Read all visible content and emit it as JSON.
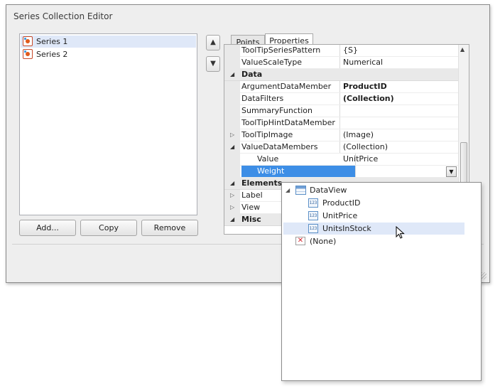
{
  "window": {
    "title": "Series Collection Editor"
  },
  "series_list": {
    "items": [
      "Series 1",
      "Series 2"
    ],
    "selected": 0
  },
  "buttons": {
    "add": "Add...",
    "copy": "Copy",
    "remove": "Remove"
  },
  "tabs": [
    {
      "label": "Points",
      "active": false
    },
    {
      "label": "Properties",
      "active": true
    }
  ],
  "property_grid": {
    "rows": [
      {
        "name": "ToolTipSeriesPattern",
        "value": "{S}"
      },
      {
        "name": "ValueScaleType",
        "value": "Numerical"
      },
      {
        "category": "Data"
      },
      {
        "name": "ArgumentDataMember",
        "value": "ProductID"
      },
      {
        "name": "DataFilters",
        "value": "(Collection)"
      },
      {
        "name": "SummaryFunction",
        "value": ""
      },
      {
        "name": "ToolTipHintDataMember",
        "value": ""
      },
      {
        "name": "ToolTipImage",
        "value": "(Image)"
      },
      {
        "name": "ValueDataMembers",
        "value": "(Collection)"
      },
      {
        "name": "Value",
        "value": "UnitPrice"
      },
      {
        "name": "Weight",
        "value": ""
      },
      {
        "category": "Elements"
      },
      {
        "name": "Label",
        "value": ""
      },
      {
        "name": "View",
        "value": ""
      },
      {
        "category": "Misc"
      }
    ]
  },
  "dropdown": {
    "root": "DataView",
    "fields": [
      "ProductID",
      "UnitPrice",
      "UnitsInStock"
    ],
    "hovered": "UnitsInStock",
    "none": "(None)",
    "field_icon_text": "123"
  },
  "icons": {
    "expand_open": "◢",
    "expand_closed": "▷",
    "tree_open": "◢",
    "up": "▲",
    "down": "▼",
    "none_mark": "✕"
  },
  "colors": {
    "selection": "#3d8ee6",
    "hover": "#dfe8f8",
    "category_bg": "#e9e9e9"
  }
}
